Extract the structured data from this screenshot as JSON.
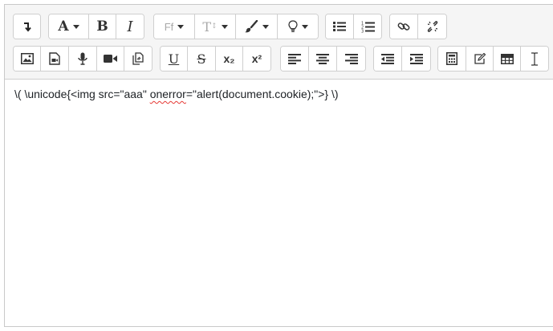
{
  "toolbar": {
    "row1": {
      "show_more_icon": "arrow-down-return-icon",
      "text_style_label": "A",
      "bold_label": "B",
      "italic_label": "I",
      "font_family_label": "Ff",
      "font_size_label": "T",
      "brush_icon": "paintbrush-icon",
      "lightbulb_icon": "lightbulb-icon",
      "unordered_list_icon": "unordered-list-icon",
      "ordered_list_icon": "ordered-list-icon",
      "link_icon": "link-icon",
      "unlink_icon": "unlink-icon"
    },
    "row2": {
      "image_icon": "image-icon",
      "media_icon": "media-file-icon",
      "mic_icon": "microphone-icon",
      "video_icon": "video-camera-icon",
      "manage_files_icon": "manage-files-icon",
      "underline_label": "U",
      "strike_label": "S",
      "subscript_label": "x₂",
      "superscript_label": "x²",
      "align_left_icon": "align-left-icon",
      "align_center_icon": "align-center-icon",
      "align_right_icon": "align-right-icon",
      "outdent_icon": "outdent-icon",
      "indent_icon": "indent-icon",
      "calculator_icon": "calculator-icon",
      "edit_icon": "edit-pencil-icon",
      "table_icon": "table-icon",
      "text_cursor_icon": "text-cursor-icon"
    }
  },
  "content": {
    "text_before": "\\( \\unicode{<img src=\"aaa\" ",
    "text_misspelled": "onerror",
    "text_after": "=\"alert(document.cookie);\">} \\)"
  }
}
